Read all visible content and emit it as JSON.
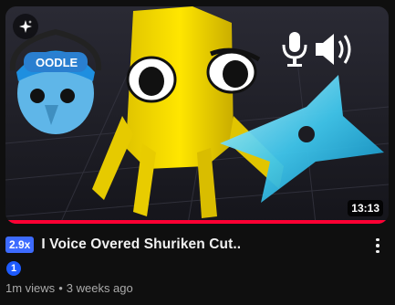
{
  "video": {
    "duration": "13:13",
    "watch_progress": 1.0,
    "speed_badge": "2.9x",
    "title": "I Voice Overed Shuriken Cut..",
    "marker": "1",
    "views": "1m views",
    "separator": "•",
    "age": "3 weeks ago"
  },
  "thumbnail": {
    "character_cap_text": "OODLE"
  },
  "icons": {
    "sparkle": "sparkle-icon",
    "more": "more-vert-icon",
    "mic": "microphone-icon",
    "speaker": "speaker-icon"
  },
  "colors": {
    "background": "#0f0f0f",
    "progress": "#ff0033",
    "speed_badge": "#3d6bff",
    "marker": "#1e5bff",
    "meta_text": "#aaaaaa"
  }
}
